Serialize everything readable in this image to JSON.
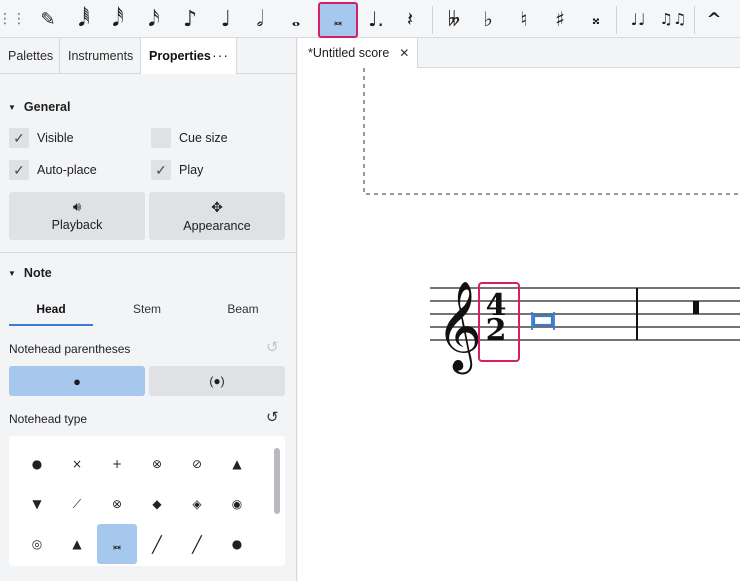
{
  "toolbar": {
    "items": [
      {
        "name": "drag-handle-icon",
        "glyph": "⋮⋮"
      },
      {
        "name": "note-input-pencil-icon",
        "glyph": "✎"
      },
      {
        "name": "duration-64th-icon",
        "glyph": "𝅘𝅥𝅱"
      },
      {
        "name": "duration-32nd-icon",
        "glyph": "𝅘𝅥𝅰"
      },
      {
        "name": "duration-16th-icon",
        "glyph": "𝅘𝅥𝅯"
      },
      {
        "name": "duration-eighth-icon",
        "glyph": "♪"
      },
      {
        "name": "duration-quarter-icon",
        "glyph": "♩"
      },
      {
        "name": "duration-half-icon",
        "glyph": "𝅗𝅥"
      },
      {
        "name": "duration-whole-icon",
        "glyph": "𝅝"
      },
      {
        "name": "duration-breve-icon",
        "glyph": "𝅜"
      },
      {
        "name": "augmentation-dot-icon",
        "glyph": "♩."
      },
      {
        "name": "rest-icon",
        "glyph": "𝄽"
      },
      {
        "name": "double-flat-icon",
        "glyph": "𝄫"
      },
      {
        "name": "flat-icon",
        "glyph": "♭"
      },
      {
        "name": "natural-icon",
        "glyph": "♮"
      },
      {
        "name": "sharp-icon",
        "glyph": "♯"
      },
      {
        "name": "double-sharp-icon",
        "glyph": "𝄪"
      },
      {
        "name": "tie-icon",
        "glyph": "♩♩"
      },
      {
        "name": "slur-icon",
        "glyph": "♫♫"
      },
      {
        "name": "marcato-icon",
        "glyph": "^"
      }
    ]
  },
  "panel": {
    "tabs": [
      "Palettes",
      "Instruments",
      "Properties"
    ],
    "more": "···",
    "general": {
      "title": "General",
      "visible": "Visible",
      "cue_size": "Cue size",
      "auto_place": "Auto-place",
      "play": "Play",
      "playback": "Playback",
      "appearance": "Appearance"
    },
    "note": {
      "title": "Note",
      "subtabs": [
        "Head",
        "Stem",
        "Beam"
      ],
      "parentheses_label": "Notehead parentheses",
      "type_label": "Notehead type"
    },
    "notehead_types": [
      "●",
      "×",
      "+",
      "⊗",
      "⊘",
      "▲",
      "▼",
      "⟋",
      "⊗",
      "◆",
      "◈",
      "◉",
      "◎",
      "▲",
      "𝅜",
      "╱",
      "╱",
      "●"
    ]
  },
  "document": {
    "tab_title": "*Untitled score",
    "close_glyph": "✕",
    "time_signature": {
      "top": "4",
      "bottom": "2"
    }
  },
  "colors": {
    "accent": "#3a7bd5",
    "selection_blue": "#a6c8ef",
    "highlight_pink": "#d61f69"
  }
}
